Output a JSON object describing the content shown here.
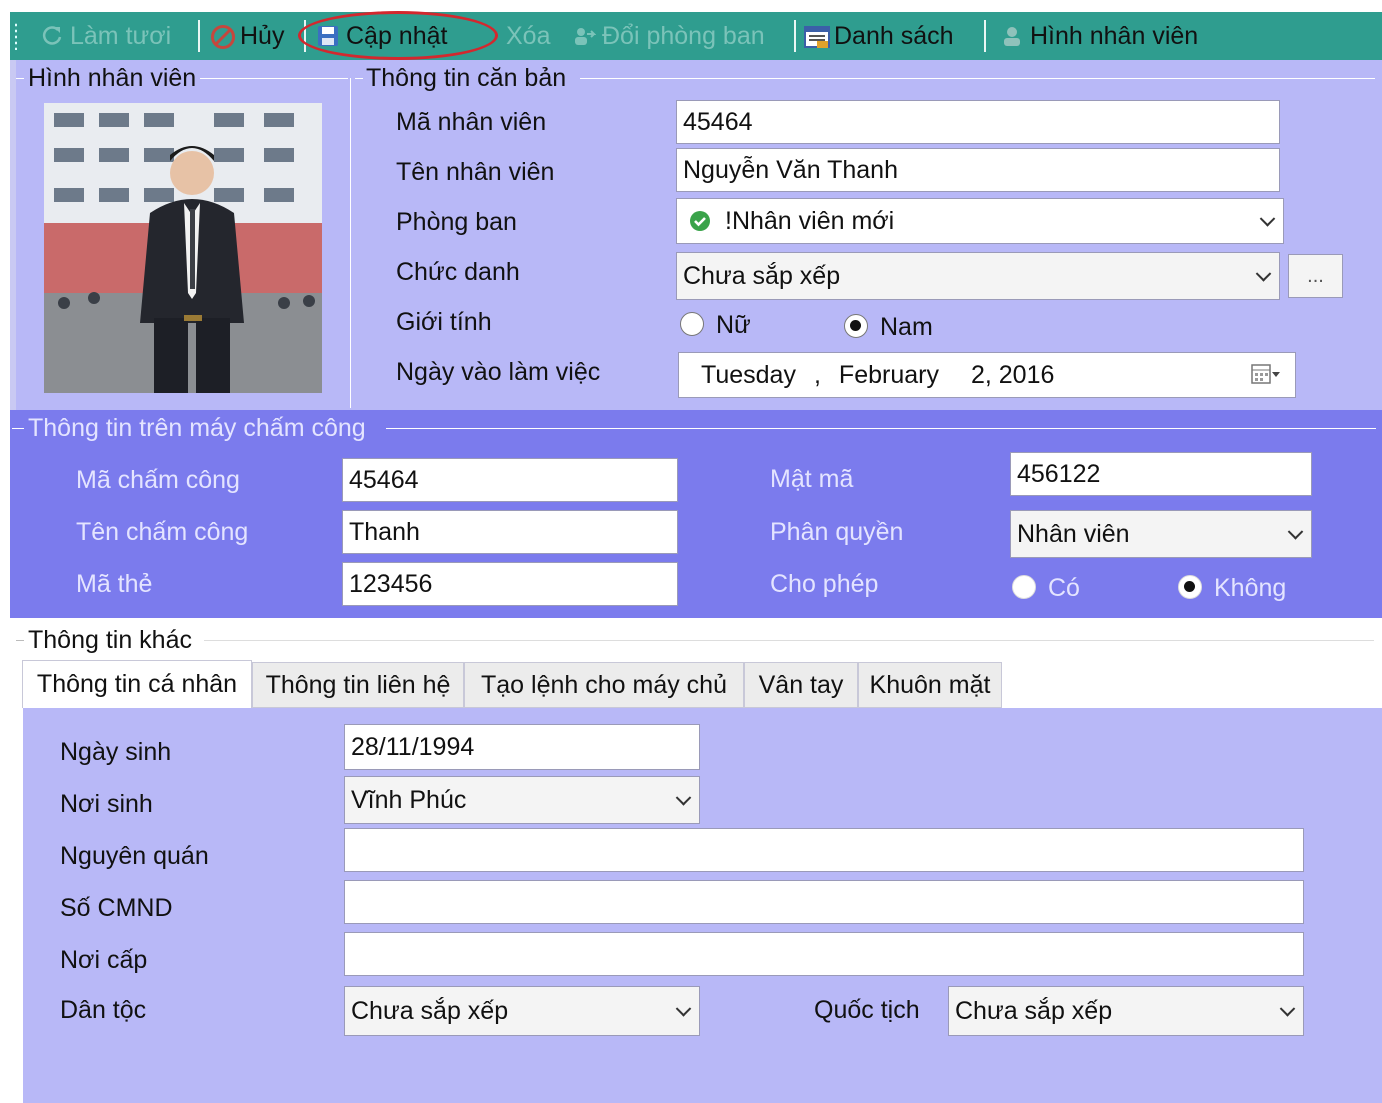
{
  "toolbar": {
    "refresh": "Làm tươi",
    "cancel": "Hủy",
    "update": "Cập nhật",
    "delete": "Xóa",
    "change_dept": "Đổi phòng ban",
    "list": "Danh sách",
    "employee_photo": "Hình nhân viên"
  },
  "photo_group": {
    "title": "Hình nhân viên"
  },
  "basic": {
    "title": "Thông tin căn bản",
    "employee_id_label": "Mã nhân viên",
    "employee_id": "45464",
    "employee_name_label": "Tên nhân viên",
    "employee_name": "Nguyễn Văn Thanh",
    "department_label": "Phòng ban",
    "department": "!Nhân viên mới",
    "position_label": "Chức danh",
    "position": "Chưa sắp xếp",
    "more_button": "...",
    "gender_label": "Giới tính",
    "gender_female": "Nữ",
    "gender_male": "Nam",
    "start_date_label": "Ngày vào làm việc",
    "start_weekday": "Tuesday",
    "start_comma": ",",
    "start_month": "February",
    "start_day_year": "2, 2016"
  },
  "timekeeper": {
    "title": "Thông tin trên máy chấm công",
    "code_label": "Mã chấm công",
    "code": "45464",
    "name_label": "Tên chấm công",
    "name": "Thanh",
    "card_label": "Mã thẻ",
    "card": "123456",
    "password_label": "Mật mã",
    "password": "456122",
    "role_label": "Phân quyền",
    "role": "Nhân viên",
    "allow_label": "Cho phép",
    "allow_yes": "Có",
    "allow_no": "Không"
  },
  "other": {
    "title": "Thông tin khác",
    "tabs": [
      "Thông tin cá nhân",
      "Thông tin liên hệ",
      "Tạo lệnh cho máy chủ",
      "Vân tay",
      "Khuôn mặt"
    ],
    "birth_date_label": "Ngày sinh",
    "birth_date": "28/11/1994",
    "birth_place_label": "Nơi sinh",
    "birth_place": "Vĩnh Phúc",
    "hometown_label": "Nguyên quán",
    "hometown": "",
    "id_number_label": "Số CMND",
    "id_number": "",
    "issue_place_label": "Nơi cấp",
    "issue_place": "",
    "ethnicity_label": "Dân tộc",
    "ethnicity": "Chưa sắp xếp",
    "nationality_label": "Quốc tịch",
    "nationality": "Chưa sắp xếp"
  },
  "colors": {
    "toolbar": "#2f9d8f",
    "panel": "#b8b8f7",
    "timekeeper_panel": "#7b7bed",
    "annotation": "#d3282e"
  }
}
